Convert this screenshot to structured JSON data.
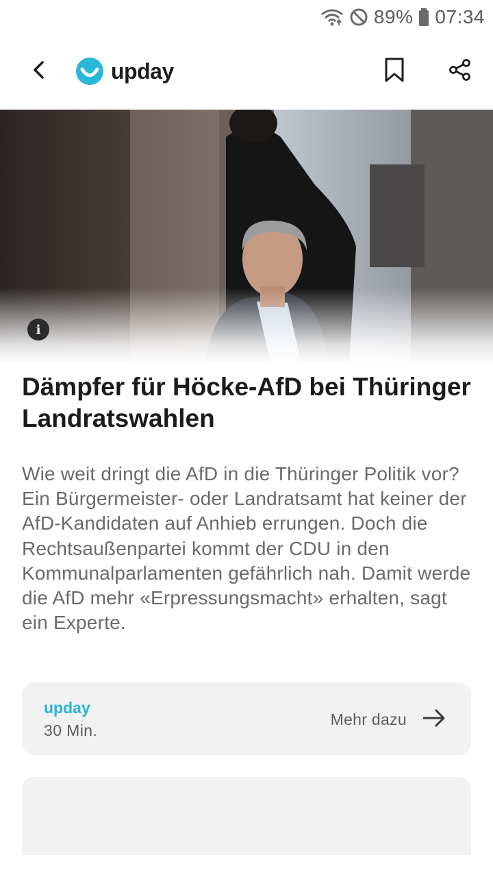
{
  "status_bar": {
    "battery_percent": "89%",
    "time": "07:34",
    "icons": [
      "wifi-icon",
      "do-not-disturb-icon",
      "battery-icon"
    ]
  },
  "app_bar": {
    "brand_name": "upday",
    "icons": [
      "back-arrow-icon",
      "upday-logo-icon",
      "bookmark-icon",
      "share-icon"
    ],
    "accent_color": "#29B6D8"
  },
  "hero": {
    "info_icon_label": "i"
  },
  "article": {
    "headline": "Dämpfer für Höcke-AfD bei Thüringer Landratswahlen",
    "summary": "Wie weit dringt die AfD in die Thüringer Politik vor? Ein Bürgermeister- oder Landratsamt hat keiner der AfD-Kandidaten auf Anhieb errungen. Doch die Rechtsaußenpartei kommt der CDU in den Kommunalparlamenten gefährlich nah. Damit werde die AfD mehr «Erpressungsmacht» erhalten, sagt ein Experte."
  },
  "source_card": {
    "source_name": "upday",
    "time_ago": "30 Min.",
    "more_label": "Mehr dazu",
    "source_color": "#2BB4D4"
  }
}
